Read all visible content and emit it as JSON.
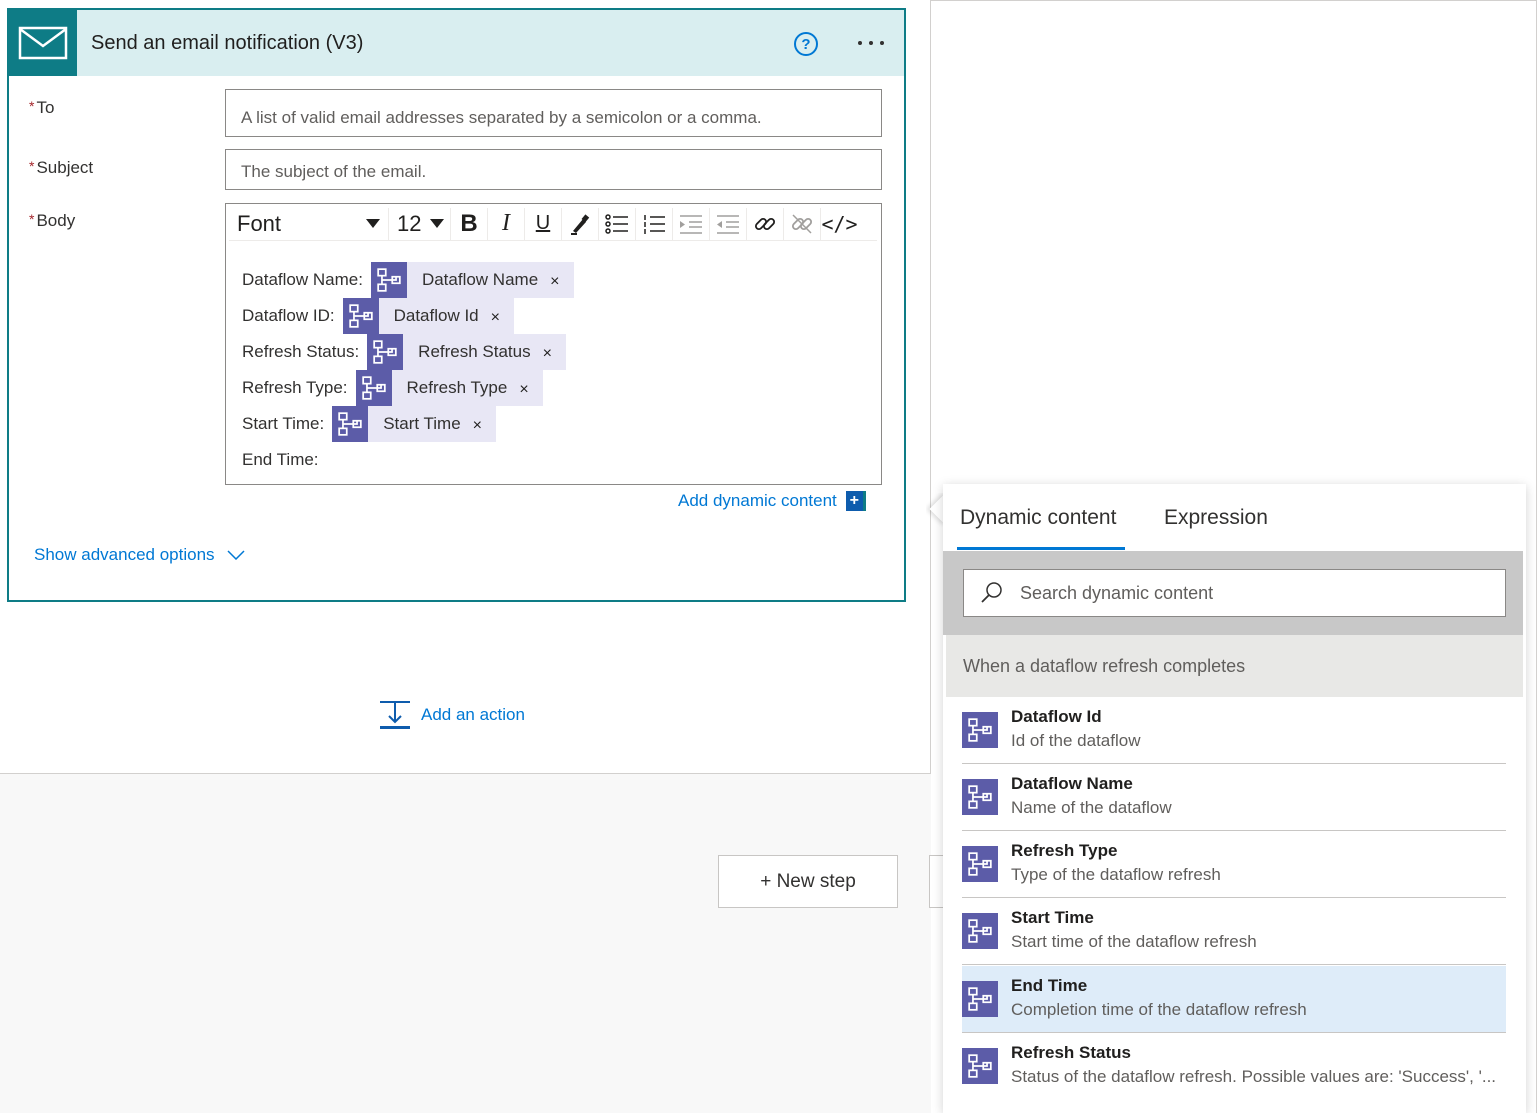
{
  "card": {
    "title": "Send an email notification (V3)",
    "help_glyph": "?",
    "accent_color": "#0e7c86"
  },
  "fields": {
    "to": {
      "label": "To",
      "placeholder": "A list of valid email addresses separated by a semicolon or a comma."
    },
    "subject": {
      "label": "Subject",
      "placeholder": "The subject of the email."
    },
    "body": {
      "label": "Body"
    },
    "required_mark": "*"
  },
  "toolbar": {
    "font": "Font",
    "size": "12",
    "bold": "B",
    "italic": "I",
    "underline": "U",
    "code": "</>"
  },
  "body_lines": [
    {
      "label": "Dataflow Name:",
      "token": "Dataflow Name"
    },
    {
      "label": "Dataflow ID:",
      "token": "Dataflow Id"
    },
    {
      "label": "Refresh Status:",
      "token": "Refresh Status"
    },
    {
      "label": "Refresh Type:",
      "token": "Refresh Type"
    },
    {
      "label": "Start Time:",
      "token": "Start Time"
    },
    {
      "label": "End Time:",
      "token": ""
    }
  ],
  "token_close": "×",
  "links": {
    "add_dynamic_content": "Add dynamic content",
    "add_dynamic_plus": "+",
    "show_advanced": "Show advanced options",
    "add_action": "Add an action"
  },
  "new_step": "+ New step",
  "panel": {
    "tabs": [
      "Dynamic content",
      "Expression"
    ],
    "active_tab": "Dynamic content",
    "search_placeholder": "Search dynamic content",
    "group_title": "When a dataflow refresh completes",
    "items": [
      {
        "name": "Dataflow Id",
        "desc": "Id of the dataflow"
      },
      {
        "name": "Dataflow Name",
        "desc": "Name of the dataflow"
      },
      {
        "name": "Refresh Type",
        "desc": "Type of the dataflow refresh"
      },
      {
        "name": "Start Time",
        "desc": "Start time of the dataflow refresh"
      },
      {
        "name": "End Time",
        "desc": "Completion time of the dataflow refresh",
        "highlighted": true
      },
      {
        "name": "Refresh Status",
        "desc": "Status of the dataflow refresh. Possible values are: 'Success', '..."
      }
    ]
  },
  "colors": {
    "link": "#0078d4",
    "token_icon": "#5c5ca8",
    "token_bg": "#e8e7f5",
    "hover": "#deecf9"
  }
}
